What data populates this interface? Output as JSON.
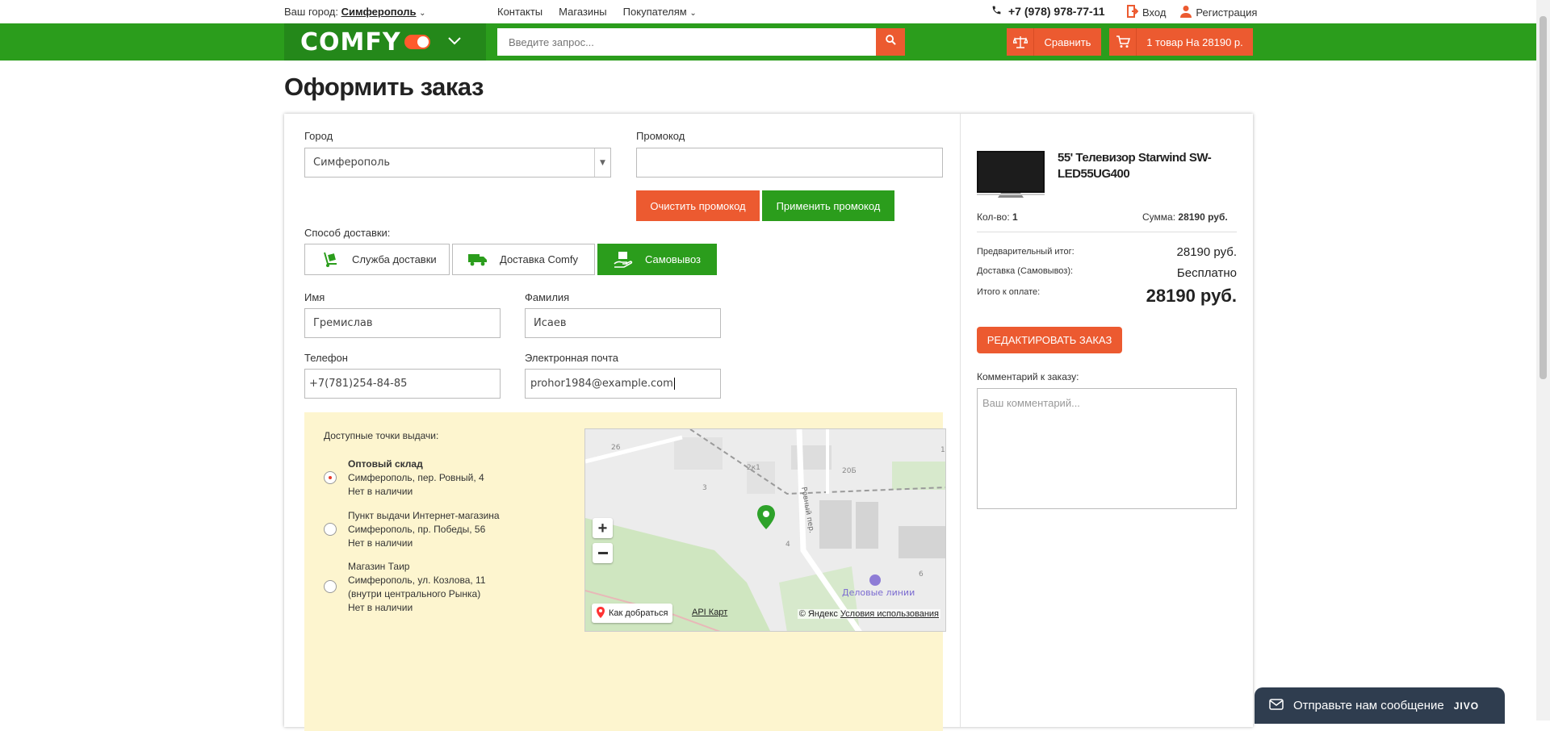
{
  "topbar": {
    "city_prefix": "Ваш город:",
    "city": "Симферополь",
    "nav": [
      "Контакты",
      "Магазины",
      "Покупателям"
    ],
    "phone": "+7 (978) 978-77-11",
    "login": "Вход",
    "register": "Регистрация"
  },
  "header": {
    "logo": "COMFY",
    "search_placeholder": "Введите запрос...",
    "compare": "Сравнить",
    "cart": "1 товар На 28190 р."
  },
  "page": {
    "title": "Оформить заказ"
  },
  "form": {
    "city_label": "Город",
    "city_value": "Симферополь",
    "promo_label": "Промокод",
    "promo_value": "",
    "clear_promo": "Очистить промокод",
    "apply_promo": "Применить промокод",
    "delivery_label": "Способ доставки:",
    "delivery_tabs": [
      "Служба доставки",
      "Доставка Comfy",
      "Самовывоз"
    ],
    "first_name_label": "Имя",
    "first_name": "Гремислав",
    "last_name_label": "Фамилия",
    "last_name": "Исаев",
    "phone_label": "Телефон",
    "phone": "+7(781)254-84-85",
    "email_label": "Электронная почта",
    "email": "prohor1984@example.com"
  },
  "pickup": {
    "title": "Доступные точки выдачи:",
    "points": [
      {
        "name": "Оптовый склад",
        "address": "Симферополь, пер. Ровный, 4",
        "status": "Нет в наличии",
        "selected": true
      },
      {
        "name": "Пункт выдачи Интернет-магазина",
        "address": "Симферополь, пр. Победы, 56",
        "status": "Нет в наличии",
        "selected": false
      },
      {
        "name": "Магазин Таир",
        "address": "Симферополь, ул. Козлова, 11 (внутри центрального Рынка)",
        "status": "Нет в наличии",
        "selected": false
      }
    ],
    "map": {
      "route_btn": "Как добраться",
      "api": "API Карт",
      "copyright": "© Яндекс",
      "terms": "Условия использования",
      "place_label": "Деловые линии",
      "street_label": "Ровный пер.",
      "house_numbers": [
        "26",
        "2к1",
        "20Б",
        "3",
        "4",
        "6",
        "1"
      ]
    }
  },
  "summary": {
    "product_name": "55' Телевизор Starwind SW-LED55UG400",
    "qty_label": "Кол-во:",
    "qty": "1",
    "sum_label": "Сумма:",
    "sum": "28190 руб.",
    "subtotal_label": "Предварительный итог:",
    "subtotal": "28190 руб.",
    "delivery_label": "Доставка (Самовывоз):",
    "delivery": "Бесплатно",
    "total_label": "Итого к оплате:",
    "total": "28190 руб.",
    "edit_order": "РЕДАКТИРОВАТЬ ЗАКАЗ",
    "comment_label": "Комментарий к заказу:",
    "comment_placeholder": "Ваш комментарий..."
  },
  "chat": {
    "label": "Отправьте нам сообщение",
    "brand": "JIVO"
  },
  "colors": {
    "green": "#2b9d1c",
    "orange": "#ec5a30",
    "pickup_bg": "#fdf5cf"
  }
}
